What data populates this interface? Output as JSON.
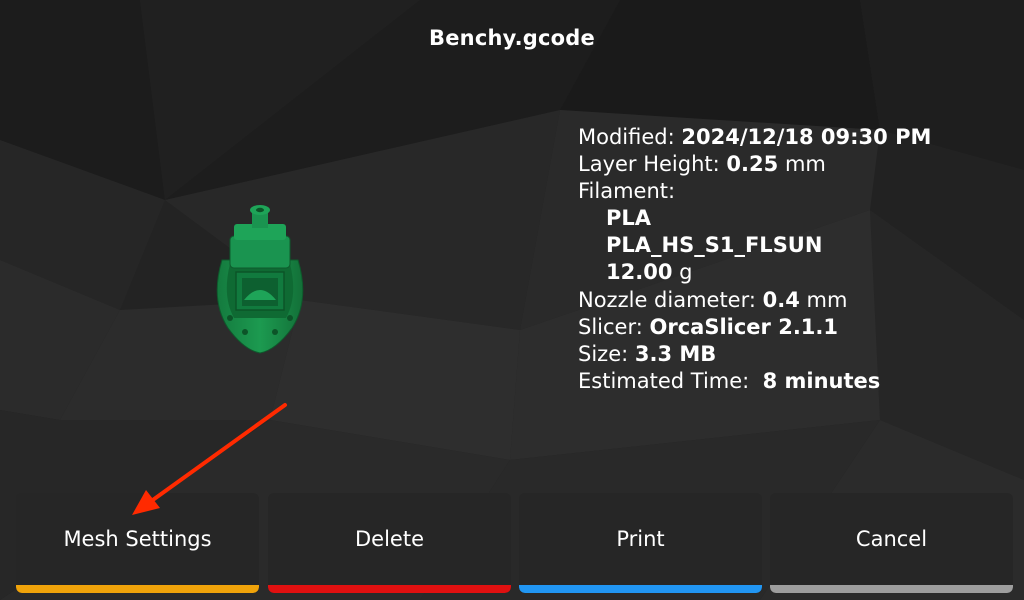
{
  "file": {
    "title": "Benchy.gcode"
  },
  "details": {
    "modified_label": "Modified:",
    "modified_value": "2024/12/18 09:30 PM",
    "layer_height_label": "Layer Height:",
    "layer_height_value": "0.25",
    "layer_height_unit": "mm",
    "filament_label": "Filament:",
    "filament_type": "PLA",
    "filament_name": "PLA_HS_S1_FLSUN",
    "filament_weight_value": "12.00",
    "filament_weight_unit": "g",
    "nozzle_label": "Nozzle diameter:",
    "nozzle_value": "0.4",
    "nozzle_unit": "mm",
    "slicer_label": "Slicer:",
    "slicer_value": "OrcaSlicer 2.1.1",
    "size_label": "Size:",
    "size_value": "3.3 MB",
    "time_label": "Estimated Time:",
    "time_value": "8 minutes"
  },
  "actions": [
    {
      "label": "Mesh Settings",
      "color": "#f0a30a"
    },
    {
      "label": "Delete",
      "color": "#e01010"
    },
    {
      "label": "Print",
      "color": "#2196f3"
    },
    {
      "label": "Cancel",
      "color": "#9e9e9e"
    }
  ],
  "annotation": {
    "arrow_color": "#ff2a00"
  },
  "thumbnail": {
    "icon": "benchy-boat-icon",
    "color": "#1a8a4a"
  }
}
